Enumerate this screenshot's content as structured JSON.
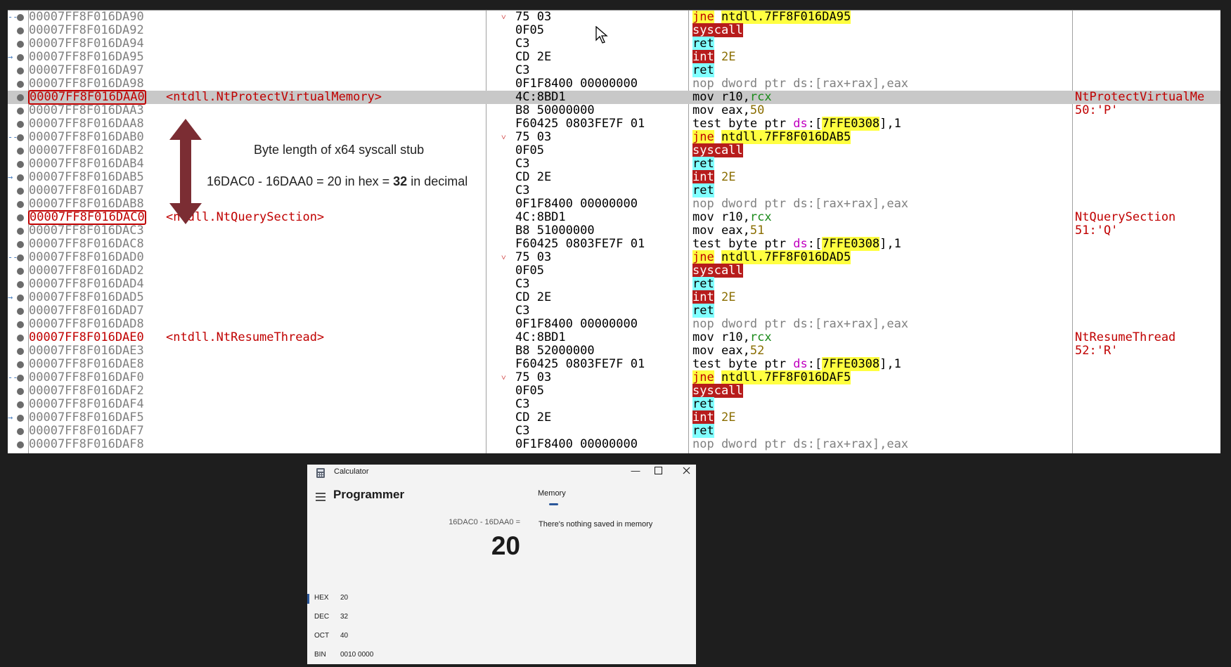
{
  "debugger": {
    "rows": [
      {
        "arrow": "--",
        "addr": "00007FF8F016DA90",
        "label": "",
        "chev": "˅",
        "bytes": "75 03",
        "dis": [
          {
            "t": "jne",
            "c": "y jne"
          },
          {
            "t": " "
          },
          {
            "t": "ntdll.7FF8F016DA95",
            "c": "y"
          }
        ],
        "cmt": ""
      },
      {
        "arrow": "",
        "addr": "00007FF8F016DA92",
        "label": "",
        "chev": "",
        "bytes": "0F05",
        "dis": [
          {
            "t": "syscall",
            "c": "kred"
          }
        ],
        "cmt": ""
      },
      {
        "arrow": "",
        "addr": "00007FF8F016DA94",
        "label": "",
        "chev": "",
        "bytes": "C3",
        "dis": [
          {
            "t": "ret",
            "c": "kcy"
          }
        ],
        "cmt": ""
      },
      {
        "arrow": "→",
        "addr": "00007FF8F016DA95",
        "label": "",
        "chev": "",
        "bytes": "CD 2E",
        "dis": [
          {
            "t": "int",
            "c": "kred"
          },
          {
            "t": " "
          },
          {
            "t": "2E",
            "c": "num"
          }
        ],
        "cmt": ""
      },
      {
        "arrow": "",
        "addr": "00007FF8F016DA97",
        "label": "",
        "chev": "",
        "bytes": "C3",
        "dis": [
          {
            "t": "ret",
            "c": "kcy"
          }
        ],
        "cmt": ""
      },
      {
        "arrow": "",
        "addr": "00007FF8F016DA98",
        "label": "",
        "chev": "",
        "bytes": "0F1F8400 00000000",
        "dis": [
          {
            "t": "nop dword ptr ds:[rax+rax],eax",
            "c": "gray"
          }
        ],
        "cmt": ""
      },
      {
        "arrow": "",
        "addr": "00007FF8F016DAA0",
        "label": "<ntdll.NtProtectVirtualMemory>",
        "chev": "",
        "bytes": "4C:8BD1",
        "dis": [
          {
            "t": "mov r10,"
          },
          {
            "t": "rcx",
            "c": "rc"
          }
        ],
        "cmt": "NtProtectVirtualMe",
        "sel": true,
        "box": true,
        "hi": true
      },
      {
        "arrow": "",
        "addr": "00007FF8F016DAA3",
        "label": "",
        "chev": "",
        "bytes": "B8 50000000",
        "dis": [
          {
            "t": "mov eax,"
          },
          {
            "t": "50",
            "c": "num"
          }
        ],
        "cmt": "50:'P'"
      },
      {
        "arrow": "",
        "addr": "00007FF8F016DAA8",
        "label": "",
        "chev": "",
        "bytes": "F60425 0803FE7F 01",
        "dis": [
          {
            "t": "test byte ptr "
          },
          {
            "t": "ds",
            "c": "ds"
          },
          {
            "t": ":["
          },
          {
            "t": "7FFE0308",
            "c": "y"
          },
          {
            "t": "],1"
          }
        ],
        "cmt": ""
      },
      {
        "arrow": "--",
        "addr": "00007FF8F016DAB0",
        "label": "",
        "chev": "˅",
        "bytes": "75 03",
        "dis": [
          {
            "t": "jne",
            "c": "y jne"
          },
          {
            "t": " "
          },
          {
            "t": "ntdll.7FF8F016DAB5",
            "c": "y"
          }
        ],
        "cmt": ""
      },
      {
        "arrow": "",
        "addr": "00007FF8F016DAB2",
        "label": "",
        "chev": "",
        "bytes": "0F05",
        "dis": [
          {
            "t": "syscall",
            "c": "kred"
          }
        ],
        "cmt": ""
      },
      {
        "arrow": "",
        "addr": "00007FF8F016DAB4",
        "label": "",
        "chev": "",
        "bytes": "C3",
        "dis": [
          {
            "t": "ret",
            "c": "kcy"
          }
        ],
        "cmt": ""
      },
      {
        "arrow": "→",
        "addr": "00007FF8F016DAB5",
        "label": "",
        "chev": "",
        "bytes": "CD 2E",
        "dis": [
          {
            "t": "int",
            "c": "kred"
          },
          {
            "t": " "
          },
          {
            "t": "2E",
            "c": "num"
          }
        ],
        "cmt": ""
      },
      {
        "arrow": "",
        "addr": "00007FF8F016DAB7",
        "label": "",
        "chev": "",
        "bytes": "C3",
        "dis": [
          {
            "t": "ret",
            "c": "kcy"
          }
        ],
        "cmt": ""
      },
      {
        "arrow": "",
        "addr": "00007FF8F016DAB8",
        "label": "",
        "chev": "",
        "bytes": "0F1F8400 00000000",
        "dis": [
          {
            "t": "nop dword ptr ds:[rax+rax],eax",
            "c": "gray"
          }
        ],
        "cmt": ""
      },
      {
        "arrow": "",
        "addr": "00007FF8F016DAC0",
        "label": "<ntdll.NtQuerySection>",
        "chev": "",
        "bytes": "4C:8BD1",
        "dis": [
          {
            "t": "mov r10,"
          },
          {
            "t": "rcx",
            "c": "rc"
          }
        ],
        "cmt": "NtQuerySection",
        "box": true,
        "hi": true
      },
      {
        "arrow": "",
        "addr": "00007FF8F016DAC3",
        "label": "",
        "chev": "",
        "bytes": "B8 51000000",
        "dis": [
          {
            "t": "mov eax,"
          },
          {
            "t": "51",
            "c": "num"
          }
        ],
        "cmt": "51:'Q'"
      },
      {
        "arrow": "",
        "addr": "00007FF8F016DAC8",
        "label": "",
        "chev": "",
        "bytes": "F60425 0803FE7F 01",
        "dis": [
          {
            "t": "test byte ptr "
          },
          {
            "t": "ds",
            "c": "ds"
          },
          {
            "t": ":["
          },
          {
            "t": "7FFE0308",
            "c": "y"
          },
          {
            "t": "],1"
          }
        ],
        "cmt": ""
      },
      {
        "arrow": "--",
        "addr": "00007FF8F016DAD0",
        "label": "",
        "chev": "˅",
        "bytes": "75 03",
        "dis": [
          {
            "t": "jne",
            "c": "y jne"
          },
          {
            "t": " "
          },
          {
            "t": "ntdll.7FF8F016DAD5",
            "c": "y"
          }
        ],
        "cmt": ""
      },
      {
        "arrow": "",
        "addr": "00007FF8F016DAD2",
        "label": "",
        "chev": "",
        "bytes": "0F05",
        "dis": [
          {
            "t": "syscall",
            "c": "kred"
          }
        ],
        "cmt": ""
      },
      {
        "arrow": "",
        "addr": "00007FF8F016DAD4",
        "label": "",
        "chev": "",
        "bytes": "C3",
        "dis": [
          {
            "t": "ret",
            "c": "kcy"
          }
        ],
        "cmt": ""
      },
      {
        "arrow": "→",
        "addr": "00007FF8F016DAD5",
        "label": "",
        "chev": "",
        "bytes": "CD 2E",
        "dis": [
          {
            "t": "int",
            "c": "kred"
          },
          {
            "t": " "
          },
          {
            "t": "2E",
            "c": "num"
          }
        ],
        "cmt": ""
      },
      {
        "arrow": "",
        "addr": "00007FF8F016DAD7",
        "label": "",
        "chev": "",
        "bytes": "C3",
        "dis": [
          {
            "t": "ret",
            "c": "kcy"
          }
        ],
        "cmt": ""
      },
      {
        "arrow": "",
        "addr": "00007FF8F016DAD8",
        "label": "",
        "chev": "",
        "bytes": "0F1F8400 00000000",
        "dis": [
          {
            "t": "nop dword ptr ds:[rax+rax],eax",
            "c": "gray"
          }
        ],
        "cmt": ""
      },
      {
        "arrow": "",
        "addr": "00007FF8F016DAE0",
        "label": "<ntdll.NtResumeThread>",
        "chev": "",
        "bytes": "4C:8BD1",
        "dis": [
          {
            "t": "mov r10,"
          },
          {
            "t": "rcx",
            "c": "rc"
          }
        ],
        "cmt": "NtResumeThread",
        "hi": true
      },
      {
        "arrow": "",
        "addr": "00007FF8F016DAE3",
        "label": "",
        "chev": "",
        "bytes": "B8 52000000",
        "dis": [
          {
            "t": "mov eax,"
          },
          {
            "t": "52",
            "c": "num"
          }
        ],
        "cmt": "52:'R'"
      },
      {
        "arrow": "",
        "addr": "00007FF8F016DAE8",
        "label": "",
        "chev": "",
        "bytes": "F60425 0803FE7F 01",
        "dis": [
          {
            "t": "test byte ptr "
          },
          {
            "t": "ds",
            "c": "ds"
          },
          {
            "t": ":["
          },
          {
            "t": "7FFE0308",
            "c": "y"
          },
          {
            "t": "],1"
          }
        ],
        "cmt": ""
      },
      {
        "arrow": "--",
        "addr": "00007FF8F016DAF0",
        "label": "",
        "chev": "˅",
        "bytes": "75 03",
        "dis": [
          {
            "t": "jne",
            "c": "y jne"
          },
          {
            "t": " "
          },
          {
            "t": "ntdll.7FF8F016DAF5",
            "c": "y"
          }
        ],
        "cmt": ""
      },
      {
        "arrow": "",
        "addr": "00007FF8F016DAF2",
        "label": "",
        "chev": "",
        "bytes": "0F05",
        "dis": [
          {
            "t": "syscall",
            "c": "kred"
          }
        ],
        "cmt": ""
      },
      {
        "arrow": "",
        "addr": "00007FF8F016DAF4",
        "label": "",
        "chev": "",
        "bytes": "C3",
        "dis": [
          {
            "t": "ret",
            "c": "kcy"
          }
        ],
        "cmt": ""
      },
      {
        "arrow": "→",
        "addr": "00007FF8F016DAF5",
        "label": "",
        "chev": "",
        "bytes": "CD 2E",
        "dis": [
          {
            "t": "int",
            "c": "kred"
          },
          {
            "t": " "
          },
          {
            "t": "2E",
            "c": "num"
          }
        ],
        "cmt": ""
      },
      {
        "arrow": "",
        "addr": "00007FF8F016DAF7",
        "label": "",
        "chev": "",
        "bytes": "C3",
        "dis": [
          {
            "t": "ret",
            "c": "kcy"
          }
        ],
        "cmt": ""
      },
      {
        "arrow": "",
        "addr": "00007FF8F016DAF8",
        "label": "",
        "chev": "",
        "bytes": "0F1F8400 00000000",
        "dis": [
          {
            "t": "nop dword ptr ds:[rax+rax],eax",
            "c": "gray"
          }
        ],
        "cmt": ""
      }
    ]
  },
  "annotation": {
    "title": "Byte length of x64 syscall stub",
    "calc_prefix": "16DAC0 - 16DAA0 = 20 in hex = ",
    "calc_bold": "32",
    "calc_suffix": " in decimal",
    "arrow_color": "#7b2d33"
  },
  "calculator": {
    "window_title": "Calculator",
    "mode": "Programmer",
    "memory_tab": "Memory",
    "memory_empty": "There's nothing saved in memory",
    "expression": "16DAC0 - 16DAA0 =",
    "result": "20",
    "bases": [
      {
        "name": "HEX",
        "value": "20"
      },
      {
        "name": "DEC",
        "value": "32"
      },
      {
        "name": "OCT",
        "value": "40"
      },
      {
        "name": "BIN",
        "value": "0010 0000"
      }
    ],
    "accent": "#2b579a"
  }
}
